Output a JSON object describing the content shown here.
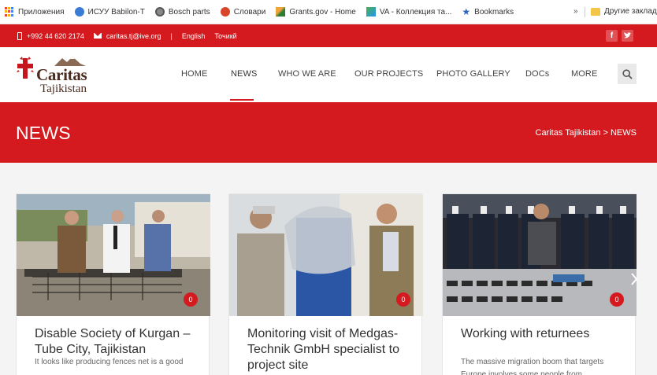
{
  "bookmarks": {
    "items": [
      {
        "label": "Приложения"
      },
      {
        "label": "ИСУУ Babilon-T"
      },
      {
        "label": "Bosch parts"
      },
      {
        "label": "Словари"
      },
      {
        "label": "Grants.gov - Home"
      },
      {
        "label": "VA - Коллекция та..."
      },
      {
        "label": "Bookmarks"
      }
    ],
    "more": "»",
    "other_label": "Другие заклад"
  },
  "topbar": {
    "phone": "+992 44 620 2174",
    "email": "caritas.tj@ive.org",
    "separator": "|",
    "lang_en": "English",
    "lang_tj": "Точикй"
  },
  "logo": {
    "name": "Caritas",
    "sub": "Tajikistan"
  },
  "nav": {
    "items": [
      {
        "label": "HOME"
      },
      {
        "label": "NEWS"
      },
      {
        "label": "WHO WE ARE"
      },
      {
        "label": "OUR PROJECTS"
      },
      {
        "label": "PHOTO GALLERY"
      },
      {
        "label": "DOCs"
      },
      {
        "label": "MORE"
      }
    ]
  },
  "hero": {
    "title": "NEWS",
    "breadcrumb": "Caritas Tajikistan > NEWS"
  },
  "cards": [
    {
      "title": "Disable Society of Kurgan – Tube City, Tajikistan",
      "comments": "0",
      "excerpt": "It looks like producing fences net is a good"
    },
    {
      "title": "Monitoring visit of Medgas-Technik GmbH specialist to project site",
      "comments": "0",
      "excerpt": ""
    },
    {
      "title": "Working with returnees",
      "comments": "0",
      "excerpt": "The massive migration boom that targets Europe involves some people from"
    }
  ],
  "colors": {
    "brand_red": "#d41a1f",
    "logo_brown": "#4a2b1e"
  }
}
